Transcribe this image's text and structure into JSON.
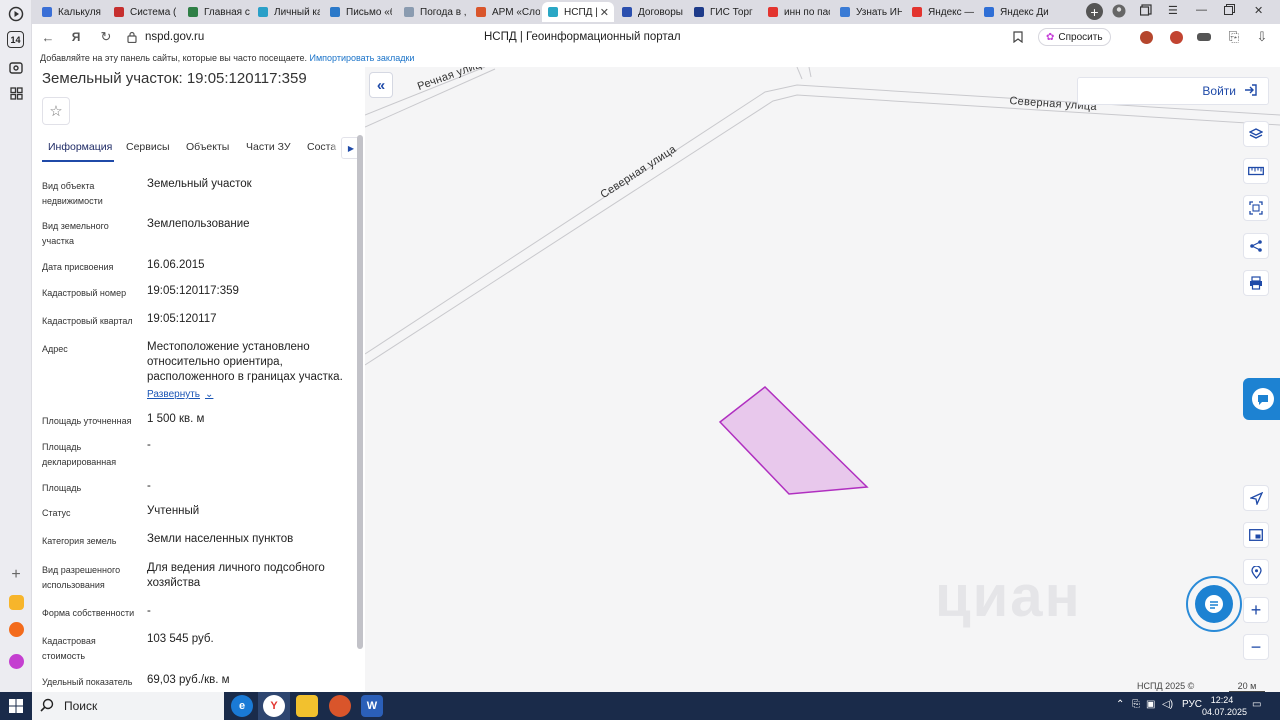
{
  "browser": {
    "rail_badge": "14",
    "tabs": [
      {
        "label": "Калькуля",
        "color": "#3a6fd6"
      },
      {
        "label": "Система (",
        "color": "#c62f2f"
      },
      {
        "label": "Главная с",
        "color": "#2f7f46"
      },
      {
        "label": "Личный ка",
        "color": "#2aa0c8"
      },
      {
        "label": "Письмо «б",
        "color": "#2b79c9"
      },
      {
        "label": "Погода в ,",
        "color": "#8a9bb0"
      },
      {
        "label": "АРМ «Сло",
        "color": "#d9552b"
      },
      {
        "label": "НСПД |",
        "color": "#2aa7c5"
      },
      {
        "label": "Договоры",
        "color": "#2b4fae"
      },
      {
        "label": "ГИС Торг",
        "color": "#1e3b8a"
      },
      {
        "label": "инн по пас",
        "color": "#e3342f"
      },
      {
        "label": "Узнать ИН",
        "color": "#3a7bd5"
      },
      {
        "label": "Яндекс —",
        "color": "#e3342f"
      },
      {
        "label": "Яндекс Ди",
        "color": "#2f6fd6"
      }
    ],
    "active_tab_index": 7,
    "url": "nspd.gov.ru",
    "page_title": "НСПД | Геоинформационный портал",
    "ask_label": "Спросить",
    "bookmark_hint": "Добавляйте на эту панель сайты, которые вы часто посещаете.",
    "bookmark_link": "Импортировать закладки"
  },
  "panel": {
    "title": "Земельный участок: 19:05:120117:359",
    "tabs": [
      "Информация",
      "Сервисы",
      "Объекты",
      "Части ЗУ",
      "Соста"
    ],
    "active_tab": "Информация",
    "tab_overflow_letter": "Г",
    "expand_label": "Развернуть",
    "rows": [
      {
        "label": "Вид объекта недвижимости",
        "value": "Земельный участок"
      },
      {
        "label": "Вид земельного участка",
        "value": "Землепользование"
      },
      {
        "label": "Дата присвоения",
        "value": "16.06.2015"
      },
      {
        "label": "Кадастровый номер",
        "value": "19:05:120117:359"
      },
      {
        "label": "Кадастровый квартал",
        "value": "19:05:120117"
      },
      {
        "label": "Адрес",
        "value": "Местоположение установлено относительно ориентира, расположенного в границах участка."
      },
      {
        "label": "Площадь уточненная",
        "value": "1 500 кв. м"
      },
      {
        "label": "Площадь декларированная",
        "value": "-"
      },
      {
        "label": "Площадь",
        "value": "-"
      },
      {
        "label": "Статус",
        "value": "Учтенный"
      },
      {
        "label": "Категория земель",
        "value": "Земли населенных пунктов"
      },
      {
        "label": "Вид разрешенного использования",
        "value": "Для ведения личного подсобного хозяйства"
      },
      {
        "label": "Форма собственности",
        "value": "-"
      },
      {
        "label": "Кадастровая стоимость",
        "value": "103 545 руб."
      },
      {
        "label": "Удельный показатель",
        "value": "69,03 руб./кв. м"
      }
    ]
  },
  "map": {
    "streets": [
      "Речная улица",
      "Северная улица",
      "Северная улица"
    ],
    "login_label": "Войти",
    "watermark": "циан",
    "copyright": "НСПД 2025 ©",
    "scale": "20 м",
    "parcel_fill": "#e8c8ec",
    "parcel_stroke": "#b02fc0"
  },
  "taskbar": {
    "search_label": "Поиск",
    "lang": "РУС",
    "time": "12:24",
    "date": "04.07.2025"
  }
}
